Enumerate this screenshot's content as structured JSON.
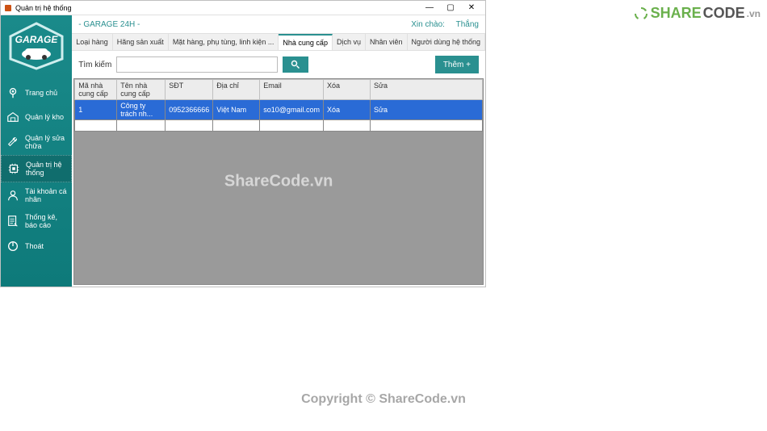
{
  "window": {
    "title": "Quản trị hệ thống"
  },
  "header": {
    "app_title": "- GARAGE 24H -",
    "greeting": "Xin chào:",
    "user": "Thắng"
  },
  "sidebar": {
    "items": [
      {
        "label": "Trang chủ"
      },
      {
        "label": "Quản lý kho"
      },
      {
        "label": "Quản lý sửa chữa"
      },
      {
        "label": "Quản trị hệ thống"
      },
      {
        "label": "Tài khoản cá nhân"
      },
      {
        "label": "Thống kê, báo cáo"
      },
      {
        "label": "Thoát"
      }
    ]
  },
  "tabs": {
    "items": [
      {
        "label": "Loại hàng"
      },
      {
        "label": "Hãng sản xuất"
      },
      {
        "label": "Mặt hàng, phụ tùng, linh kiện ..."
      },
      {
        "label": "Nhà cung cấp"
      },
      {
        "label": "Dịch vụ"
      },
      {
        "label": "Nhân viên"
      },
      {
        "label": "Người dùng hệ thống"
      }
    ],
    "active_index": 3
  },
  "toolbar": {
    "search_label": "Tìm kiếm",
    "search_placeholder": "",
    "add_label": "Thêm +"
  },
  "grid": {
    "columns": [
      "Mã nhà cung cấp",
      "Tên nhà cung cấp",
      "SĐT",
      "Địa chỉ",
      "Email",
      "Xóa",
      "Sửa"
    ],
    "rows": [
      {
        "id": "1",
        "name": "Công ty trách nh...",
        "sdt": "0952366666",
        "addr": "Việt Nam",
        "email": "so10@gmail.com",
        "del": "Xóa",
        "edit": "Sửa"
      }
    ]
  },
  "watermark": {
    "center": "ShareCode.vn",
    "footer": "Copyright © ShareCode.vn",
    "logo_share": "SHARE",
    "logo_code": "CODE",
    "logo_vn": ".vn"
  }
}
